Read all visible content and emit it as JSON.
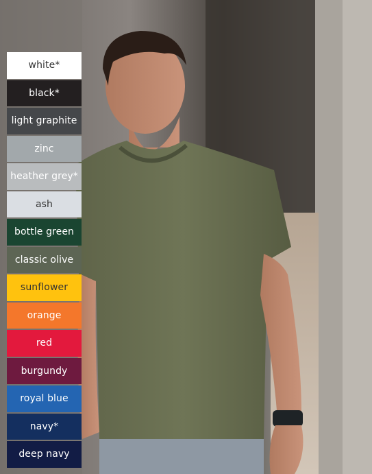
{
  "colors": [
    {
      "label": "white*",
      "bg": "#ffffff",
      "fg": "#333333"
    },
    {
      "label": "black*",
      "bg": "#231f20",
      "fg": "#ffffff"
    },
    {
      "label": "light graphite",
      "bg": "#45474a",
      "fg": "#ffffff"
    },
    {
      "label": "zinc",
      "bg": "#a2a8ab",
      "fg": "#ffffff"
    },
    {
      "label": "heather grey*",
      "bg": "#b9bcbe",
      "fg": "#ffffff"
    },
    {
      "label": "ash",
      "bg": "#dadee3",
      "fg": "#333333"
    },
    {
      "label": "bottle green",
      "bg": "#1a4531",
      "fg": "#ffffff"
    },
    {
      "label": "classic olive",
      "bg": "#5d6554",
      "fg": "#ffffff"
    },
    {
      "label": "sunflower",
      "bg": "#ffc20e",
      "fg": "#333333"
    },
    {
      "label": "orange",
      "bg": "#f4772b",
      "fg": "#ffffff"
    },
    {
      "label": "red",
      "bg": "#e3193d",
      "fg": "#ffffff"
    },
    {
      "label": "burgundy",
      "bg": "#6e1a3f",
      "fg": "#ffffff"
    },
    {
      "label": "royal blue",
      "bg": "#2465b2",
      "fg": "#ffffff"
    },
    {
      "label": "navy*",
      "bg": "#142f5f",
      "fg": "#ffffff"
    },
    {
      "label": "deep navy",
      "bg": "#121c45",
      "fg": "#ffffff"
    }
  ]
}
